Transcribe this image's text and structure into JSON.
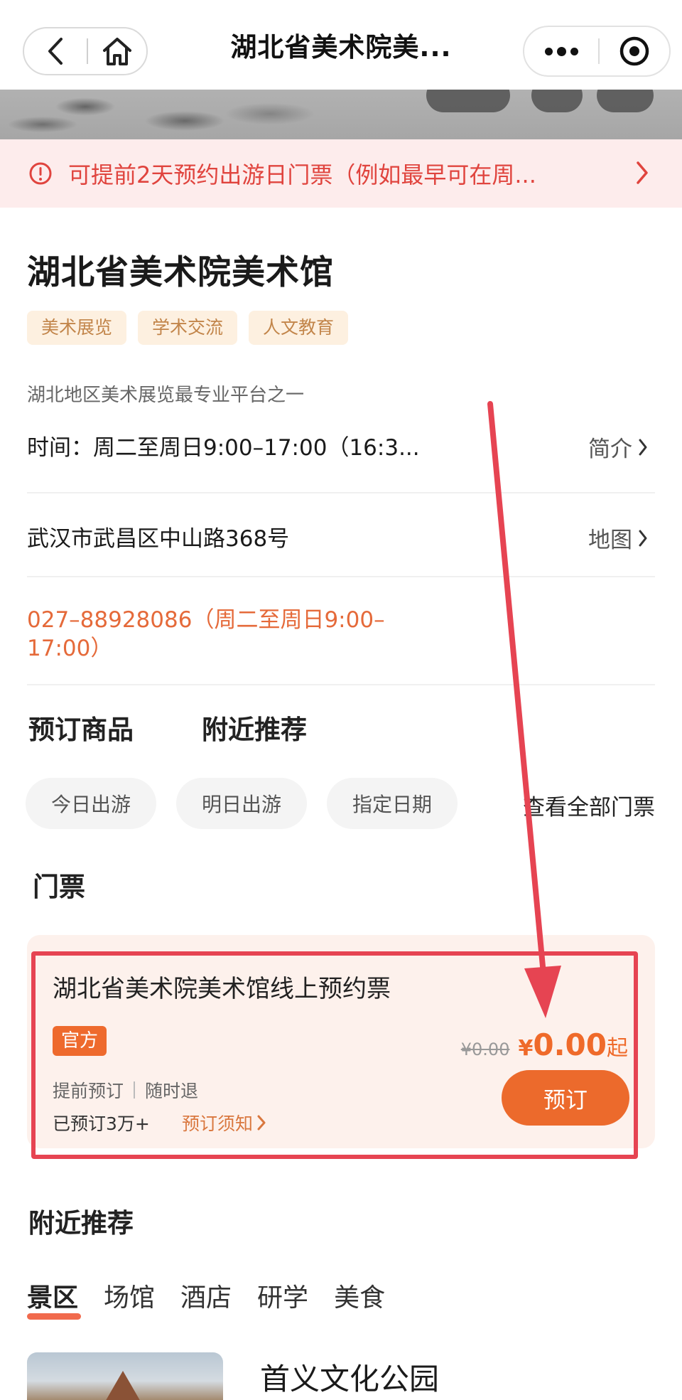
{
  "nav": {
    "title": "湖北省美术院美...",
    "back_icon": "back-arrow-icon",
    "home_icon": "home-icon",
    "more_icon": "more-dots-icon",
    "capsule_icon": "record-target-icon"
  },
  "notice": {
    "text": "可提前2天预约出游日门票（例如最早可在周...",
    "icon": "alert-circle-icon"
  },
  "venue": {
    "name": "湖北省美术院美术馆",
    "tags": [
      "美术展览",
      "学术交流",
      "人文教育"
    ],
    "description": "湖北地区美术展览最专业平台之一",
    "hours": "时间：周二至周日9:00–17:00（16:3...",
    "intro_label": "简介",
    "address": "武汉市武昌区中山路368号",
    "map_label": "地图",
    "phone": "027–88928086（周二至周日9:00–17:00）"
  },
  "section_tabs": [
    "预订商品",
    "附近推荐"
  ],
  "date_filters": [
    "今日出游",
    "明日出游",
    "指定日期"
  ],
  "all_tickets_label": "查看全部门票",
  "ticket_section_title": "门票",
  "ticket": {
    "name": "湖北省美术院美术馆线上预约票",
    "badge": "官方",
    "features": [
      "提前预订",
      "随时退"
    ],
    "sold": "已预订3万+",
    "notice_link": "预订须知",
    "original_price": "¥0.00",
    "price_symbol": "¥",
    "price": "0.00",
    "price_suffix": "起",
    "book_label": "预订"
  },
  "nearby": {
    "title": "附近推荐",
    "categories": [
      "景区",
      "场馆",
      "酒店",
      "研学",
      "美食"
    ],
    "active_category": "景区",
    "first_place": "首义文化公园"
  },
  "colors": {
    "accent": "#ec6a2c",
    "notice_bg": "#fdecec",
    "notice_text": "#e0443e",
    "tag_bg": "#fdf0e0",
    "annotation_red": "#e64452"
  }
}
